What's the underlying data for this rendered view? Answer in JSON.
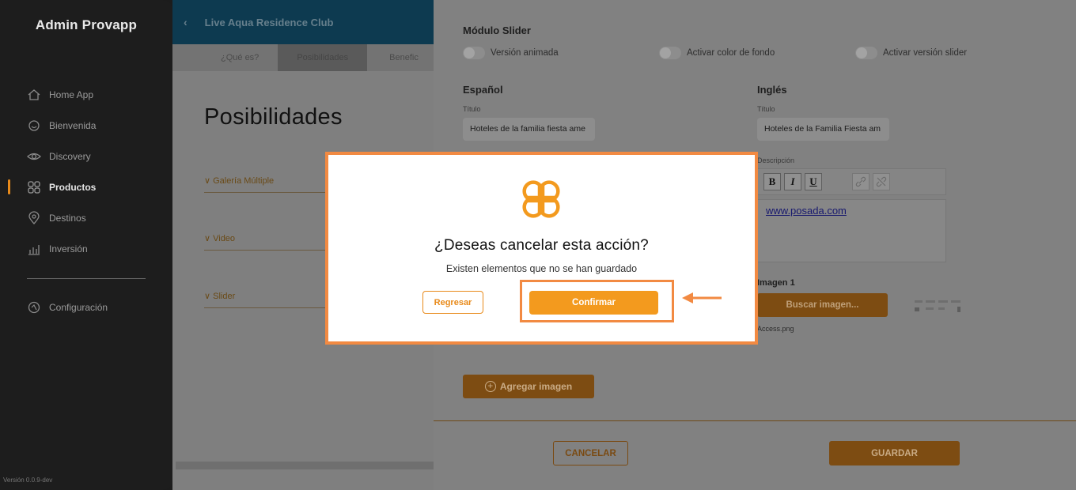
{
  "sidebar": {
    "brand": "Admin Provapp",
    "items": [
      {
        "label": "Home App",
        "icon": "home-icon"
      },
      {
        "label": "Bienvenida",
        "icon": "welcome-icon"
      },
      {
        "label": "Discovery",
        "icon": "eye-icon"
      },
      {
        "label": "Productos",
        "icon": "grid-icon",
        "active": true
      },
      {
        "label": "Destinos",
        "icon": "location-pin-icon"
      },
      {
        "label": "Inversión",
        "icon": "chart-icon"
      }
    ],
    "settings_label": "Configuración",
    "version": "Versión 0.0.9-dev"
  },
  "background_page": {
    "header_title": "Live Aqua Residence Club",
    "tabs": [
      "¿Qué es?",
      "Posibilidades",
      "Benefic"
    ],
    "page_title": "Posibilidades",
    "accordions": [
      "Galería Múltiple",
      "Video",
      "Slider"
    ]
  },
  "panel": {
    "title": "Módulo Slider",
    "toggles": [
      "Versión animada",
      "Activar color de fondo",
      "Activar versión slider"
    ],
    "spanish": {
      "heading": "Español",
      "title_label": "Título",
      "title_value": "Hoteles de la familia fiesta ame"
    },
    "english": {
      "heading": "Inglés",
      "title_label": "Título",
      "title_value": "Hoteles de la Familia Fiesta am",
      "description_label": "Descripción",
      "description_link": "www.posada.com"
    },
    "editor_buttons": {
      "bold": "B",
      "italic": "I",
      "underline": "U"
    },
    "image_label": "Imagen 1",
    "search_image_button": "Buscar imagen...",
    "file_name": "Access.png",
    "add_image_button": "Agregar imagen",
    "cancel_button": "CANCELAR",
    "save_button": "GUARDAR"
  },
  "modal": {
    "title": "¿Deseas cancelar esta acción?",
    "subtitle": "Existen elementos que no se han guardado",
    "back_button": "Regresar",
    "confirm_button": "Confirmar",
    "accent_color": "#f39a1e",
    "highlight_color": "#f28a42"
  }
}
